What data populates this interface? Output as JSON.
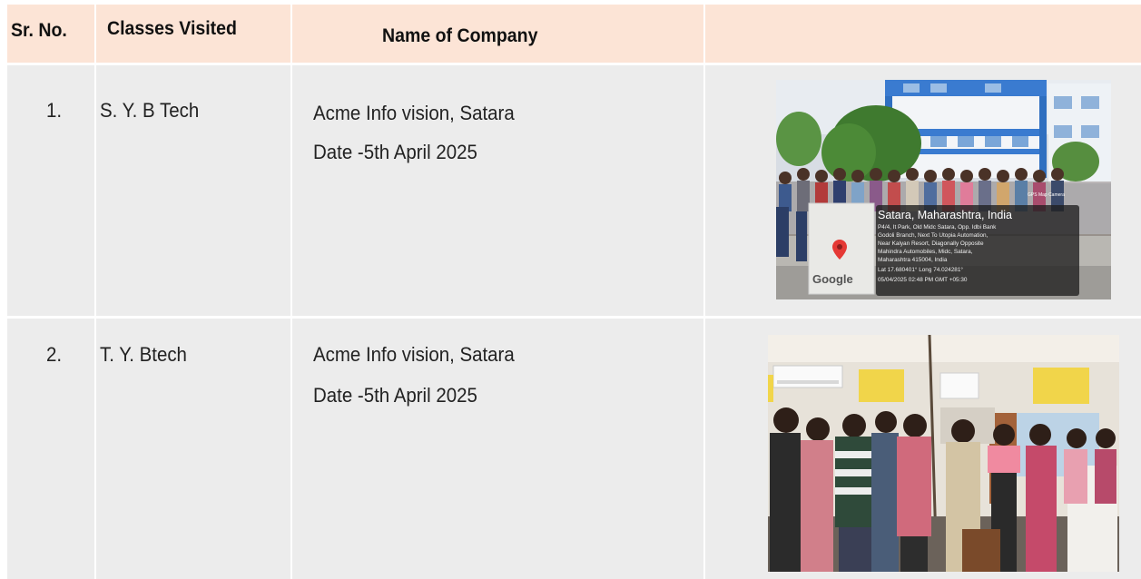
{
  "header": {
    "sr_no": "Sr. No.",
    "classes": "Classes Visited",
    "company": "Name of Company",
    "photo": ""
  },
  "rows": [
    {
      "sr": "1.",
      "class": "S. Y. B Tech",
      "company": "Acme Info vision, Satara",
      "date": "Date -5th April 2025",
      "photo": {
        "app_label": "GPS Map Camera",
        "location": "Satara, Maharashtra, India",
        "address": [
          "P4/4, It Park, Old Midc Satara, Opp. Idbi Bank",
          "Godoli Branch, Next To Utopia Automation,",
          "Near Kalyan Resort, Diagonally Opposite",
          "Mahindra Automobiles, Midc, Satara,",
          "Maharashtra 415004, India"
        ],
        "coords": "Lat 17.680401° Long 74.024281°",
        "timestamp": "05/04/2025 02:48 PM GMT +05:30",
        "map_brand": "Google"
      }
    },
    {
      "sr": "2.",
      "class": "T. Y. Btech",
      "company": "Acme Info vision, Satara",
      "date": "Date -5th April 2025"
    }
  ],
  "colors": {
    "header_bg": "#fce4d6",
    "row_bg": "#ececec",
    "grid_line": "#ffffff"
  }
}
